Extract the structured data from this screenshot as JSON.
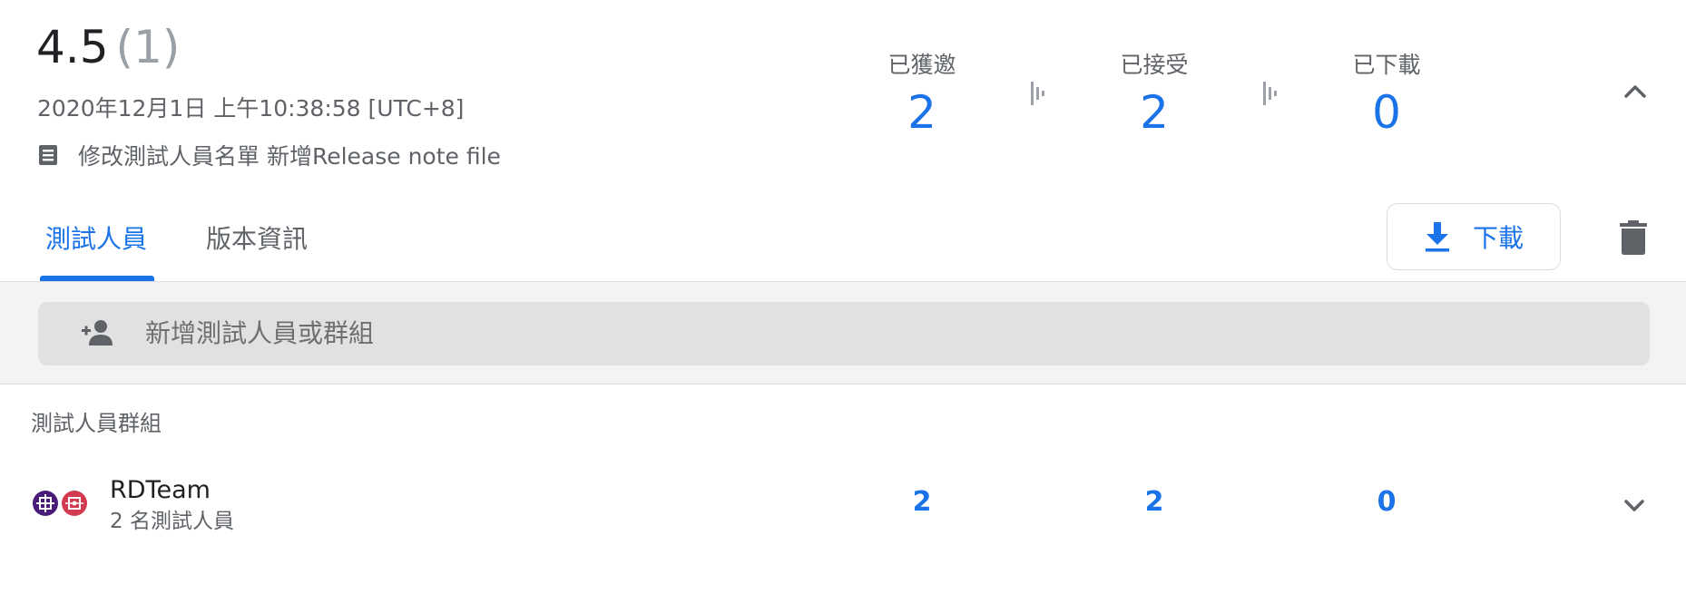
{
  "release": {
    "version": "4.5",
    "count": "(1)",
    "timestamp": "2020年12月1日 上午10:38:58 [UTC+8]",
    "note": "修改測試人員名單 新增Release note file"
  },
  "stats": [
    {
      "label": "已獲邀",
      "value": "2"
    },
    {
      "label": "已接受",
      "value": "2"
    },
    {
      "label": "已下載",
      "value": "0"
    }
  ],
  "tabs": [
    {
      "label": "測試人員",
      "active": true
    },
    {
      "label": "版本資訊",
      "active": false
    }
  ],
  "actions": {
    "download_label": "下載"
  },
  "search": {
    "placeholder": "新增測試人員或群組"
  },
  "groups": {
    "section_title": "測試人員群組",
    "items": [
      {
        "name": "RDTeam",
        "subtitle": "2 名測試人員",
        "invited": "2",
        "accepted": "2",
        "downloaded": "0"
      }
    ]
  },
  "colors": {
    "accent": "#1a73e8",
    "band_bg": "#f3f3f3",
    "search_bg": "#e1e1e1"
  },
  "icons": [
    "notes-icon",
    "separator-icon",
    "chevron-up-icon",
    "download-icon",
    "trash-icon",
    "add-person-icon",
    "avatar-icon",
    "chevron-down-icon"
  ]
}
